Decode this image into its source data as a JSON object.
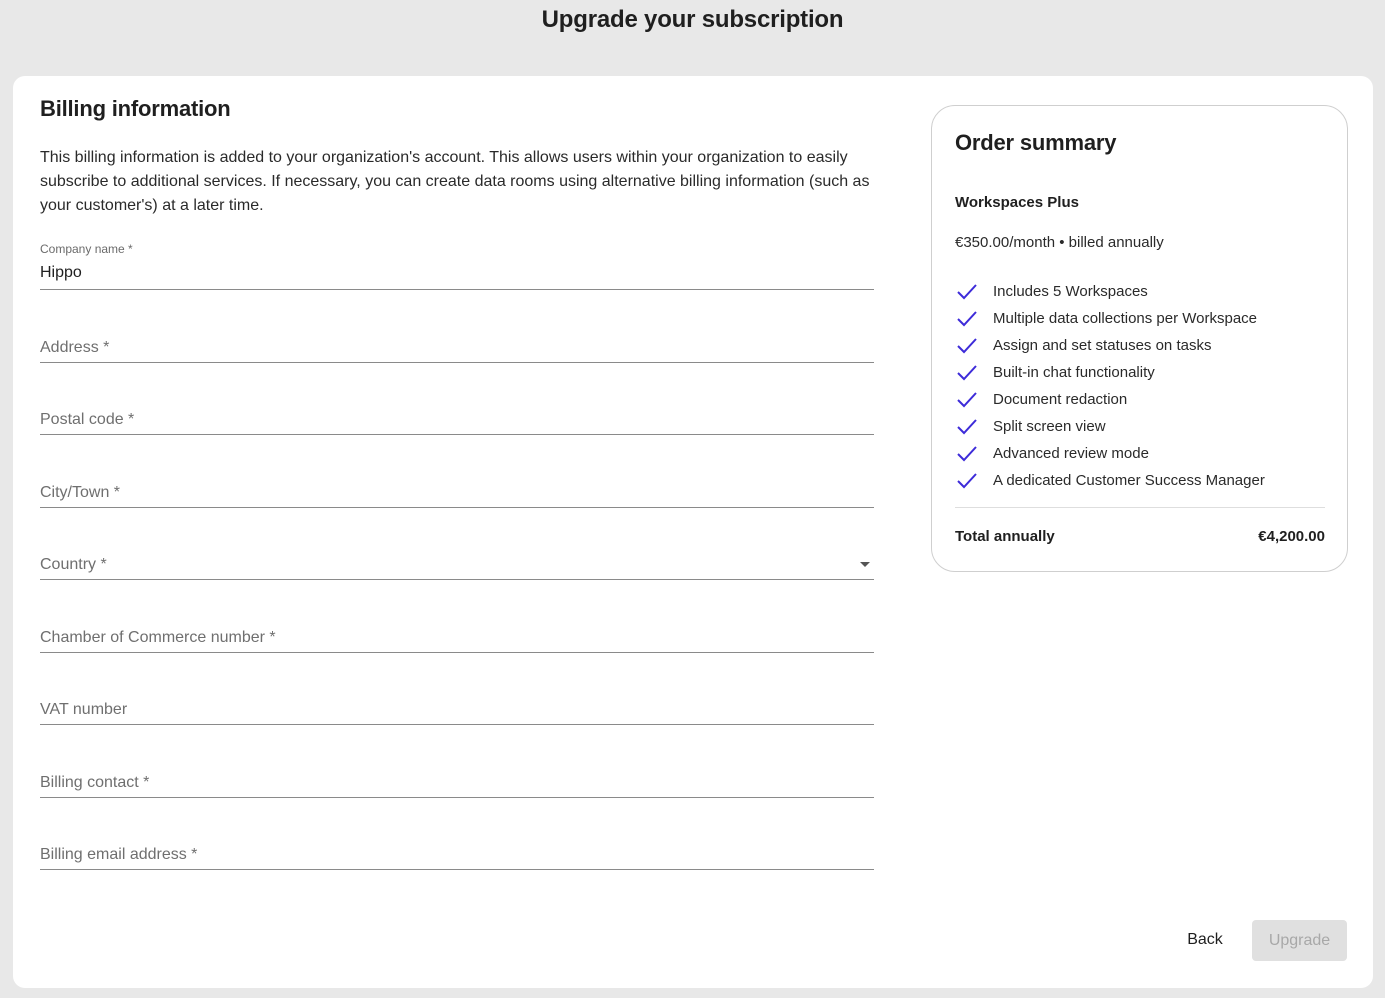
{
  "page": {
    "title": "Upgrade your subscription"
  },
  "billing": {
    "title": "Billing information",
    "description": "This billing information is added to your organization's account. This allows users within your organization to easily subscribe to additional services. If necessary, you can create data rooms using alternative billing information (such as your customer's) at a later time.",
    "fields": {
      "company": {
        "label": "Company name *",
        "value": "Hippo"
      },
      "address": {
        "placeholder": "Address *"
      },
      "postal": {
        "placeholder": "Postal code *"
      },
      "city": {
        "placeholder": "City/Town *"
      },
      "country": {
        "placeholder": "Country *"
      },
      "coc": {
        "placeholder": "Chamber of Commerce number *"
      },
      "vat": {
        "placeholder": "VAT number"
      },
      "contact": {
        "placeholder": "Billing contact *"
      },
      "email": {
        "placeholder": "Billing email address *"
      }
    }
  },
  "summary": {
    "title": "Order summary",
    "plan_name": "Workspaces Plus",
    "price": "€350.00/month • billed annually",
    "features": [
      "Includes 5 Workspaces",
      "Multiple data collections per Workspace",
      "Assign and set statuses on tasks",
      "Built-in chat functionality",
      "Document redaction",
      "Split screen view",
      "Advanced review mode",
      "A dedicated Customer Success Manager"
    ],
    "check_icon": "check-icon",
    "check_color": "#3d2bd9",
    "total_label": "Total annually",
    "total_value": "€4,200.00"
  },
  "actions": {
    "back_label": "Back",
    "upgrade_label": "Upgrade",
    "upgrade_disabled": true
  }
}
